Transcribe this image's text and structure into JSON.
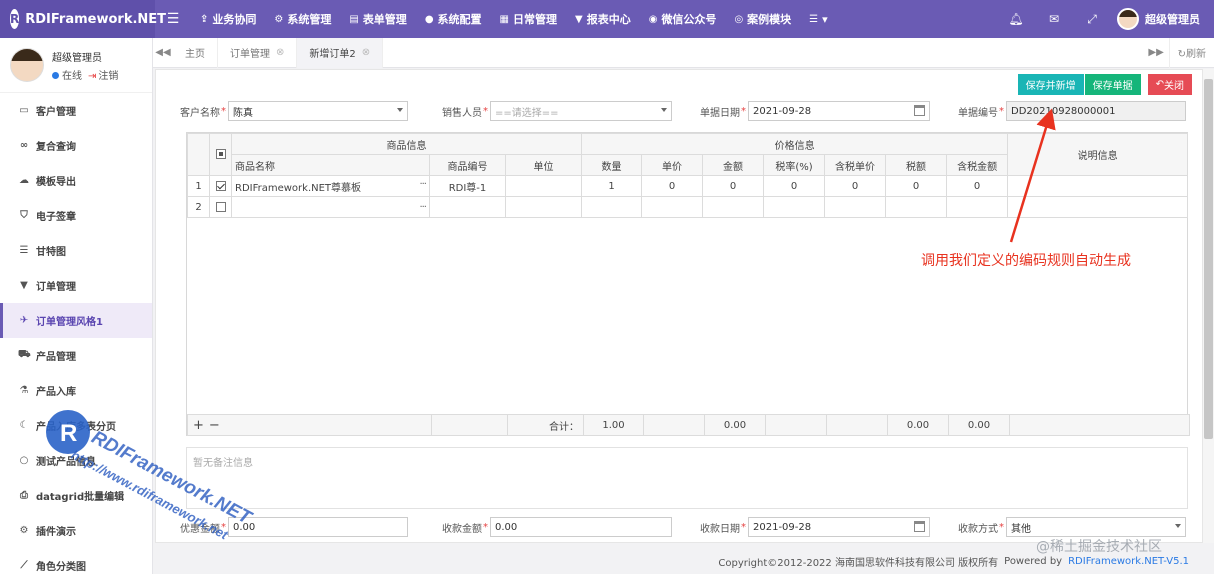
{
  "brand": {
    "title": "RDIFramework.NET",
    "logo_letter": "R"
  },
  "topnav": {
    "items": [
      {
        "label": "业务协同",
        "icon": "share-icon"
      },
      {
        "label": "系统管理",
        "icon": "cogs-icon"
      },
      {
        "label": "表单管理",
        "icon": "form-icon"
      },
      {
        "label": "系统配置",
        "icon": "circle-icon"
      },
      {
        "label": "日常管理",
        "icon": "calendar-icon"
      },
      {
        "label": "报表中心",
        "icon": "filter-icon"
      },
      {
        "label": "微信公众号",
        "icon": "wechat-icon"
      },
      {
        "label": "案例模块",
        "icon": "eye-icon"
      }
    ],
    "user": "超级管理员"
  },
  "sidebar": {
    "user_name": "超级管理员",
    "status_online": "在线",
    "status_logout": "注销",
    "items": [
      {
        "label": "客户管理",
        "icon": "idcard-icon"
      },
      {
        "label": "复合查询",
        "icon": "binoculars-icon"
      },
      {
        "label": "模板导出",
        "icon": "cloud-icon"
      },
      {
        "label": "电子签章",
        "icon": "shield-icon"
      },
      {
        "label": "甘特图",
        "icon": "sliders-icon"
      },
      {
        "label": "订单管理",
        "icon": "filter-icon"
      },
      {
        "label": "订单管理风格1",
        "icon": "plane-icon",
        "active": true
      },
      {
        "label": "产品管理",
        "icon": "cart-icon"
      },
      {
        "label": "产品入库",
        "icon": "bottle-icon"
      },
      {
        "label": "产品入库多表分页",
        "icon": "moon-icon"
      },
      {
        "label": "测试产品信息",
        "icon": "circle-icon"
      },
      {
        "label": "datagrid批量编辑",
        "icon": "print-icon"
      },
      {
        "label": "插件演示",
        "icon": "cogs-icon"
      },
      {
        "label": "角色分类图",
        "icon": "chart-icon"
      }
    ]
  },
  "tabs": {
    "items": [
      {
        "label": "主页",
        "closable": false
      },
      {
        "label": "订单管理",
        "closable": true
      },
      {
        "label": "新增订单2",
        "closable": true,
        "active": true
      }
    ],
    "refresh": "刷新"
  },
  "toolbar": {
    "save_new": "保存并新增",
    "save": "保存单据",
    "close": "关闭"
  },
  "form": {
    "customer_label": "客户名称",
    "customer_value": "陈真",
    "sales_label": "销售人员",
    "sales_placeholder": "==请选择==",
    "date_label": "单据日期",
    "date_value": "2021-09-28",
    "code_label": "单据编号",
    "code_value": "DD20210928000001"
  },
  "grid": {
    "group_product": "商品信息",
    "group_price": "价格信息",
    "remark_header": "说明信息",
    "columns": [
      "商品名称",
      "商品编号",
      "单位",
      "数量",
      "单价",
      "金额",
      "税率(%)",
      "含税单价",
      "税额",
      "含税金额"
    ],
    "rows": [
      {
        "no": "1",
        "checked": true,
        "name": "RDIFramework.NET尊慕板",
        "code": "RDI尊-1",
        "unit": "",
        "qty": "1",
        "price": "0",
        "amount": "0",
        "tax_rate": "0",
        "tax_price": "0",
        "tax": "0",
        "tax_amount": "0"
      },
      {
        "no": "2",
        "checked": false,
        "name": "",
        "code": "",
        "unit": "",
        "qty": "",
        "price": "",
        "amount": "",
        "tax_rate": "",
        "tax_price": "",
        "tax": "",
        "tax_amount": ""
      }
    ],
    "footer": {
      "add": "+",
      "remove": "−",
      "total_label": "合计：",
      "qty": "1.00",
      "amount": "0.00",
      "tax": "0.00",
      "tax_amount": "0.00"
    }
  },
  "remarks_placeholder": "暂无备注信息",
  "bottom_form": {
    "discount_label": "优惠金额",
    "discount_value": "0.00",
    "received_label": "收款金额",
    "received_value": "0.00",
    "received_date_label": "收款日期",
    "received_date_value": "2021-09-28",
    "pay_method_label": "收款方式",
    "pay_method_value": "其他"
  },
  "annotation": "调用我们定义的编码规则自动生成",
  "footer": {
    "copyright": "Copyright©2012-2022 海南国思软件科技有限公司 版权所有",
    "powered": "Powered by",
    "powered_link": "RDIFramework.NET-V5.1"
  },
  "watermark": {
    "line1": "RDIFramework.NET",
    "line2": "http://www.rdiframework.net"
  },
  "corner_watermark": "@稀土掘金技术社区",
  "colors": {
    "topbar": "#6a5bb4",
    "accent": "#5a45b0",
    "btn_save_new": "#19b5b5",
    "btn_save": "#15b57a",
    "btn_close": "#e64b55",
    "annotation": "#e8321f"
  }
}
